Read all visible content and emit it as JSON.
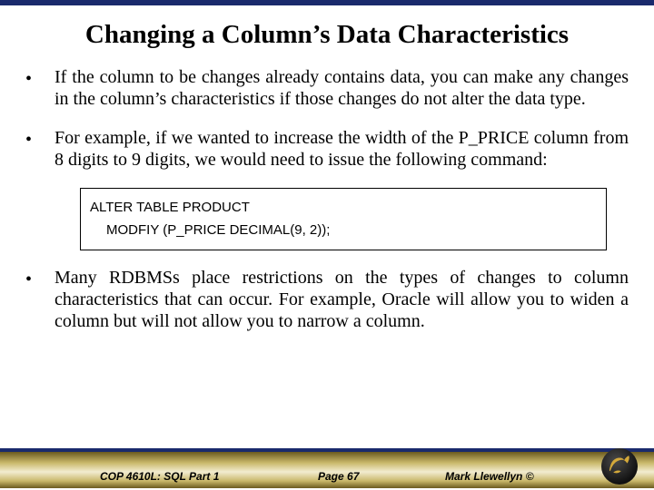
{
  "title": "Changing a Column’s Data Characteristics",
  "bullets": [
    "If the column to be changes already contains data, you can make any changes in the column’s characteristics if those changes do not alter the data type.",
    "For example, if we wanted to increase the width of the P_PRICE column from 8 digits to 9 digits, we would need to issue the following command:",
    "Many RDBMSs place restrictions on the types of changes to column characteristics that can occur.  For example, Oracle will allow you to widen a column but will not allow you to narrow a column."
  ],
  "code": {
    "line1": "ALTER TABLE  PRODUCT",
    "line2": "MODFIY (P_PRICE DECIMAL(9, 2));"
  },
  "footer": {
    "course": "COP 4610L: SQL Part 1",
    "page": "Page 67",
    "author": "Mark Llewellyn ©"
  }
}
